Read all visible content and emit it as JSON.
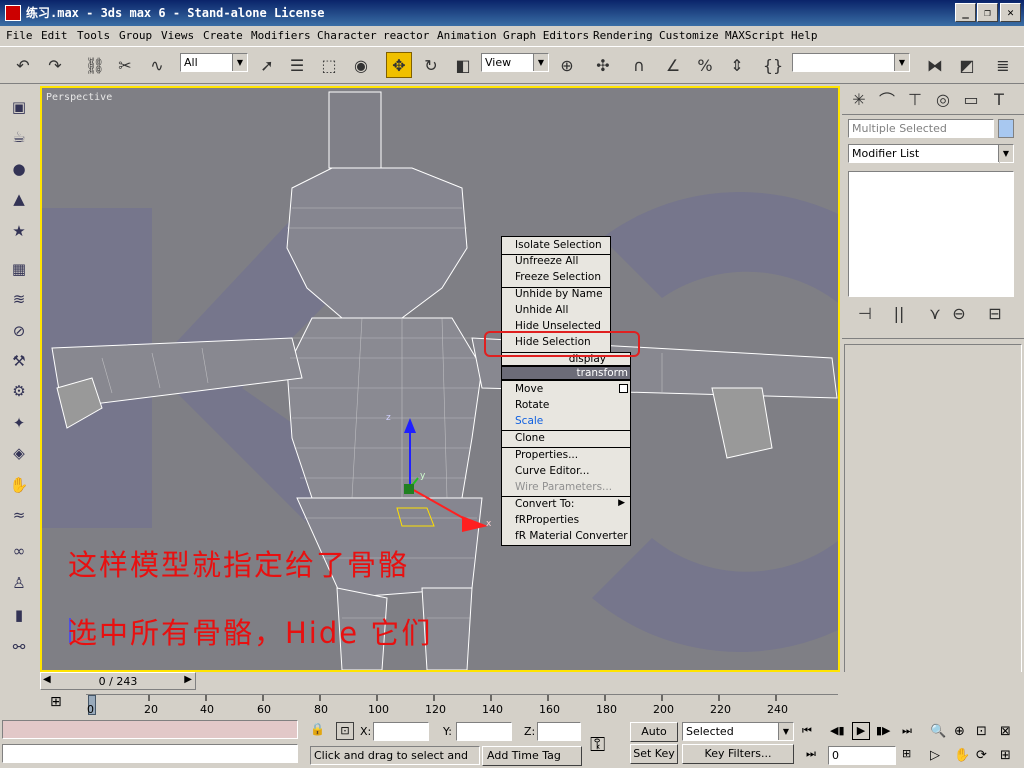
{
  "window": {
    "title": "练习.max - 3ds max 6 - Stand-alone License",
    "minimize_glyph": "_",
    "maximize_glyph": "❐",
    "close_glyph": "✕"
  },
  "menu": [
    "File",
    "Edit",
    "Tools",
    "Group",
    "Views",
    "Create",
    "Modifiers",
    "Character",
    "reactor",
    "Animation",
    "Graph Editors",
    "Rendering",
    "Customize",
    "MAXScript",
    "Help"
  ],
  "toolbar": {
    "selection_filter": "All",
    "reference_coord": "View",
    "named_selection": "",
    "icons": [
      "undo-icon",
      "redo-icon",
      "select-link-icon",
      "unlink-icon",
      "bind-spacewarp-icon",
      "select-object-icon",
      "select-by-name-icon",
      "rect-region-icon",
      "window-crossing-icon",
      "select-move-icon",
      "select-rotate-icon",
      "select-scale-icon",
      "pivot-icon",
      "mirror-icon",
      "align-icon",
      "snap-icon",
      "angle-snap-icon",
      "percent-snap-icon",
      "spinner-snap-icon",
      "edit-named-sel-icon",
      "layers-icon"
    ]
  },
  "viewport": {
    "label": "Perspective",
    "axis_x": "x",
    "axis_y": "y",
    "axis_z": "z",
    "notes": [
      "这样模型就指定给了骨骼",
      "选中所有骨骼，Hide 它们"
    ]
  },
  "quad_menu": {
    "top_items": [
      {
        "label": "Isolate Selection"
      },
      {
        "label": "Unfreeze All"
      },
      {
        "label": "Freeze Selection"
      },
      {
        "label": "Unhide by Name"
      },
      {
        "label": "Unhide All"
      },
      {
        "label": "Hide Unselected"
      },
      {
        "label": "Hide Selection"
      }
    ],
    "section_display": "display",
    "section_transform": "transform",
    "bottom_items": [
      {
        "label": "Move"
      },
      {
        "label": "Rotate"
      },
      {
        "label": "Scale"
      },
      {
        "label": "Clone"
      },
      {
        "label": "Properties..."
      },
      {
        "label": "Curve Editor..."
      },
      {
        "label": "Wire Parameters..."
      },
      {
        "label": "Convert To:"
      },
      {
        "label": "fRProperties"
      },
      {
        "label": "fR Material Converter"
      }
    ],
    "colors": {
      "highlight_text": "#1060e0",
      "disabled_text": "#909090",
      "annotation": "#e02020"
    }
  },
  "command_panel": {
    "object_name": "Multiple Selected",
    "modifier_list": "Modifier List"
  },
  "timeline": {
    "frame_indicator": "0 / 243",
    "ticks": [
      "0",
      "20",
      "40",
      "60",
      "80",
      "100",
      "120",
      "140",
      "160",
      "180",
      "200",
      "220",
      "240"
    ]
  },
  "status": {
    "x_label": "X:",
    "y_label": "Y:",
    "z_label": "Z:",
    "x_value": "",
    "y_value": "",
    "z_value": "",
    "prompt": "Click and drag to select and move",
    "add_time_tag": "Add Time Tag",
    "auto_key": "Auto Key",
    "set_key": "Set Key",
    "key_mode": "Selected",
    "key_filters": "Key Filters...",
    "current_frame": "0"
  }
}
